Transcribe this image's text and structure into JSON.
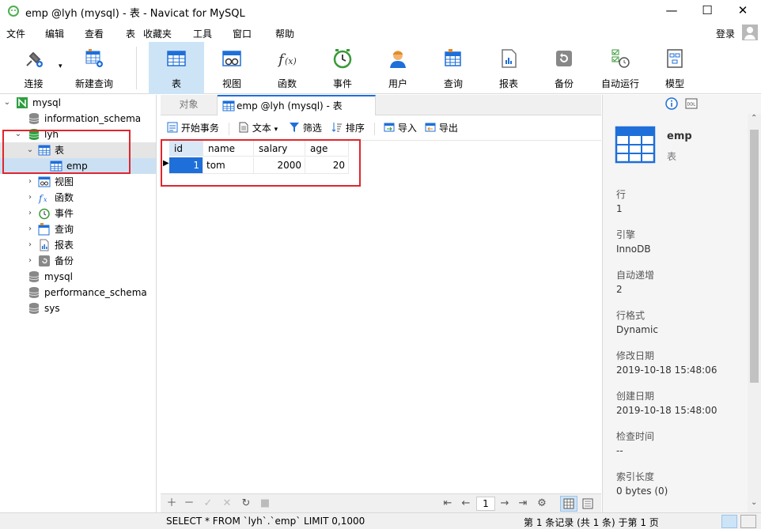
{
  "window": {
    "title": "emp @lyh (mysql) - 表 - Navicat for MySQL",
    "minimize": "—",
    "maximize": "☐",
    "close": "✕"
  },
  "menu": [
    "文件",
    "编辑",
    "查看",
    "表",
    "收藏夹",
    "工具",
    "窗口",
    "帮助"
  ],
  "login_label": "登录",
  "toolbar": [
    {
      "label": "连接",
      "icon": "plug-icon"
    },
    {
      "label": "新建查询",
      "icon": "new-query-icon"
    },
    {
      "label": "表",
      "icon": "table-icon",
      "active": true
    },
    {
      "label": "视图",
      "icon": "view-icon"
    },
    {
      "label": "函数",
      "icon": "function-icon"
    },
    {
      "label": "事件",
      "icon": "clock-icon"
    },
    {
      "label": "用户",
      "icon": "user-icon"
    },
    {
      "label": "查询",
      "icon": "query-icon"
    },
    {
      "label": "报表",
      "icon": "report-icon"
    },
    {
      "label": "备份",
      "icon": "backup-icon"
    },
    {
      "label": "自动运行",
      "icon": "autorun-icon"
    },
    {
      "label": "模型",
      "icon": "model-icon"
    }
  ],
  "tree": {
    "connection": "mysql",
    "databases": [
      "information_schema",
      "lyh"
    ],
    "lyh_children": [
      "表",
      "视图",
      "函数",
      "事件",
      "查询",
      "报表",
      "备份"
    ],
    "table_item": "emp",
    "other_dbs": [
      "mysql",
      "performance_schema",
      "sys"
    ]
  },
  "tabs": {
    "objects": "对象",
    "active": "emp @lyh (mysql) - 表"
  },
  "subtoolbar": {
    "begin_tx": "开始事务",
    "text": "文本",
    "filter": "筛选",
    "sort": "排序",
    "import": "导入",
    "export": "导出"
  },
  "grid": {
    "columns": [
      "id",
      "name",
      "salary",
      "age"
    ],
    "rows": [
      [
        "1",
        "tom",
        "2000",
        "20"
      ]
    ]
  },
  "gridnav": {
    "page": "1"
  },
  "info": {
    "name": "emp",
    "type": "表",
    "fields": [
      {
        "label": "行",
        "value": "1"
      },
      {
        "label": "引擎",
        "value": "InnoDB"
      },
      {
        "label": "自动递增",
        "value": "2"
      },
      {
        "label": "行格式",
        "value": "Dynamic"
      },
      {
        "label": "修改日期",
        "value": "2019-10-18 15:48:06"
      },
      {
        "label": "创建日期",
        "value": "2019-10-18 15:48:00"
      },
      {
        "label": "检查时间",
        "value": "--"
      },
      {
        "label": "索引长度",
        "value": "0 bytes (0)"
      }
    ]
  },
  "status": {
    "sql": "SELECT * FROM `lyh`.`emp` LIMIT 0,1000",
    "records": "第 1 条记录 (共 1 条) 于第 1 页"
  },
  "colors": {
    "accent": "#1e6fd9",
    "active_tab": "#cde4f7",
    "highlight_box": "#e0262d",
    "db_green": "#2e9e3f"
  }
}
